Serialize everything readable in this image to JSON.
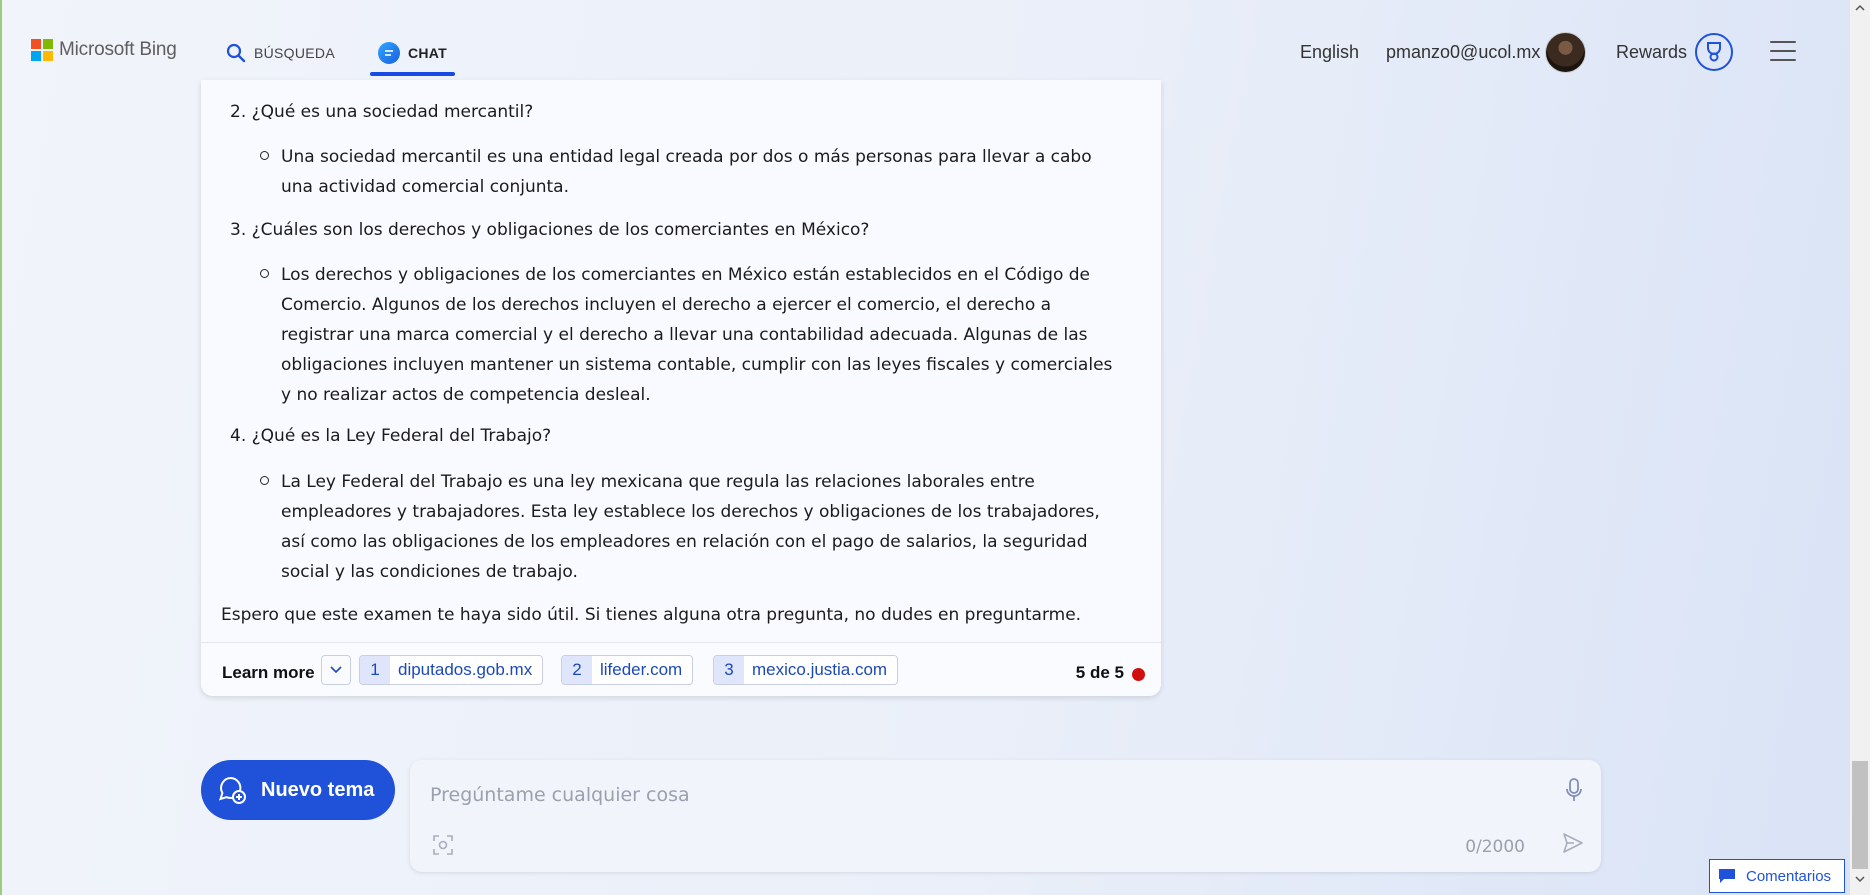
{
  "header": {
    "brand": "Microsoft Bing",
    "tabs": [
      {
        "label": "BÚSQUEDA",
        "active": false
      },
      {
        "label": "CHAT",
        "active": true
      }
    ],
    "language": "English",
    "user_email": "pmanzo0@ucol.mx",
    "rewards_label": "Rewards"
  },
  "answer": {
    "items": [
      {
        "number": "2.",
        "question": "¿Qué es una sociedad mercantil?",
        "answer_lines": [
          "Una sociedad mercantil es una entidad legal creada por dos o más personas para llevar a cabo",
          "una actividad comercial conjunta."
        ]
      },
      {
        "number": "3.",
        "question": "¿Cuáles son los derechos y obligaciones de los comerciantes en México?",
        "answer_lines": [
          "Los derechos y obligaciones de los comerciantes en México están establecidos en el Código de",
          "Comercio. Algunos de los derechos incluyen el derecho a ejercer el comercio, el derecho a",
          "registrar una marca comercial y el derecho a llevar una contabilidad adecuada. Algunas de las",
          "obligaciones incluyen mantener un sistema contable, cumplir con las leyes fiscales y comerciales",
          "y no realizar actos de competencia desleal."
        ]
      },
      {
        "number": "4.",
        "question": "¿Qué es la Ley Federal del Trabajo?",
        "answer_lines": [
          "La Ley Federal del Trabajo es una ley mexicana que regula las relaciones laborales entre",
          "empleadores y trabajadores. Esta ley establece los derechos y obligaciones de los trabajadores,",
          "así como las obligaciones de los empleadores en relación con el pago de salarios, la seguridad",
          "social y las condiciones de trabajo."
        ]
      }
    ],
    "closing": "Espero que este examen te haya sido útil. Si tienes alguna otra pregunta, no dudes en preguntarme."
  },
  "footer": {
    "learn_more": "Learn more",
    "sources": [
      {
        "num": "1",
        "label": "diputados.gob.mx"
      },
      {
        "num": "2",
        "label": "lifeder.com"
      },
      {
        "num": "3",
        "label": "mexico.justia.com"
      }
    ],
    "turn_count": "5 de 5"
  },
  "composer": {
    "new_topic": "Nuevo tema",
    "placeholder": "Pregúntame cualquier cosa",
    "char_counter": "0/2000"
  },
  "feedback_label": "Comentarios",
  "colors": {
    "accent": "#1f52d9",
    "link": "#1d49b8",
    "limit_dot": "#d01010"
  },
  "icons": [
    "search-icon",
    "chat-icon",
    "rewards-trophy-icon",
    "hamburger-menu-icon",
    "chevron-down-icon",
    "new-topic-icon",
    "microphone-icon",
    "image-scan-icon",
    "send-icon",
    "feedback-icon"
  ]
}
